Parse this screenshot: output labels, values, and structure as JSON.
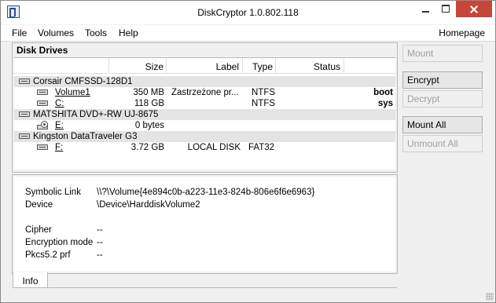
{
  "window": {
    "title": "DiskCryptor 1.0.802.118"
  },
  "menu": {
    "file": "File",
    "volumes": "Volumes",
    "tools": "Tools",
    "help": "Help",
    "homepage": "Homepage"
  },
  "drives": {
    "group_title": "Disk Drives",
    "columns": {
      "name": "",
      "size": "Size",
      "label": "Label",
      "type": "Type",
      "status": "Status"
    },
    "rows": [
      {
        "kind": "disk",
        "name": "Corsair CMFSSD-128D1"
      },
      {
        "kind": "volume",
        "name": "Volume1",
        "size": "350 MB",
        "label": "Zastrzeżone pr...",
        "type": "NTFS",
        "flag": "boot"
      },
      {
        "kind": "volume",
        "name": "C:",
        "size": "118 GB",
        "label": "",
        "type": "NTFS",
        "flag": "sys"
      },
      {
        "kind": "disk",
        "name": "MATSHITA DVD+-RW UJ-8675"
      },
      {
        "kind": "volume",
        "name": "E:",
        "size": "0 bytes",
        "label": "",
        "type": "",
        "flag": ""
      },
      {
        "kind": "disk",
        "name": "Kingston DataTraveler G3"
      },
      {
        "kind": "volume",
        "name": "F:",
        "size": "3.72 GB",
        "label": "LOCAL DISK",
        "type": "FAT32",
        "flag": ""
      }
    ]
  },
  "info": {
    "tab_label": "Info",
    "symbolic_link_label": "Symbolic Link",
    "symbolic_link_value": "\\\\?\\Volume{4e894c0b-a223-11e3-824b-806e6f6e6963}",
    "device_label": "Device",
    "device_value": "\\Device\\HarddiskVolume2",
    "cipher_label": "Cipher",
    "cipher_value": "--",
    "encryption_mode_label": "Encryption mode",
    "encryption_mode_value": "--",
    "pkcs_label": "Pkcs5.2 prf",
    "pkcs_value": "--"
  },
  "buttons": {
    "mount": "Mount",
    "encrypt": "Encrypt",
    "decrypt": "Decrypt",
    "mount_all": "Mount All",
    "unmount_all": "Unmount All"
  }
}
